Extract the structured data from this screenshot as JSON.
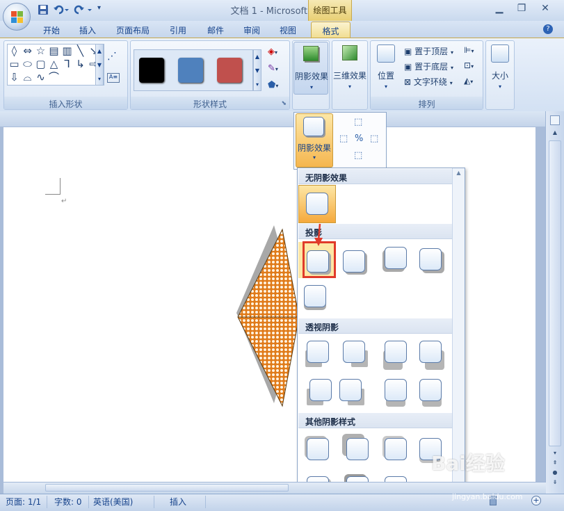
{
  "title_bar": {
    "title": "文档 1 - Microsoft Word",
    "context_tab_group": "绘图工具",
    "minimize_icon": "minimize-icon",
    "maximize_icon": "restore-icon",
    "close_icon": "close-icon"
  },
  "tabs": [
    {
      "label": "开始"
    },
    {
      "label": "插入"
    },
    {
      "label": "页面布局"
    },
    {
      "label": "引用"
    },
    {
      "label": "邮件"
    },
    {
      "label": "审阅"
    },
    {
      "label": "视图"
    },
    {
      "label": "格式",
      "active": true
    }
  ],
  "ribbon": {
    "insert_shapes": {
      "label": "插入形状"
    },
    "shape_styles": {
      "label": "形状样式",
      "swatches": [
        "#000000",
        "#4f81bd",
        "#c0504d"
      ]
    },
    "shadow_effects": {
      "label": "阴影效果"
    },
    "threed_effects": {
      "label": "三维效果"
    },
    "arrange": {
      "label": "排列",
      "position": "位置",
      "bring_to_front": "置于顶层",
      "send_to_back": "置于底层",
      "text_wrap": "文字环绕"
    },
    "size": {
      "label": "大小"
    }
  },
  "flyout": {
    "shadow_effects": "阴影效果"
  },
  "gallery": {
    "sections": [
      {
        "label": "无阴影效果"
      },
      {
        "label": "投影"
      },
      {
        "label": "透视阴影"
      },
      {
        "label": "其他阴影样式"
      }
    ]
  },
  "status_bar": {
    "page": "页面: 1/1",
    "words": "字数: 0",
    "language": "英语(美国)",
    "mode": "插入"
  },
  "watermark": {
    "text": "Bai经验",
    "sub": "jingyan.baidu.com"
  }
}
